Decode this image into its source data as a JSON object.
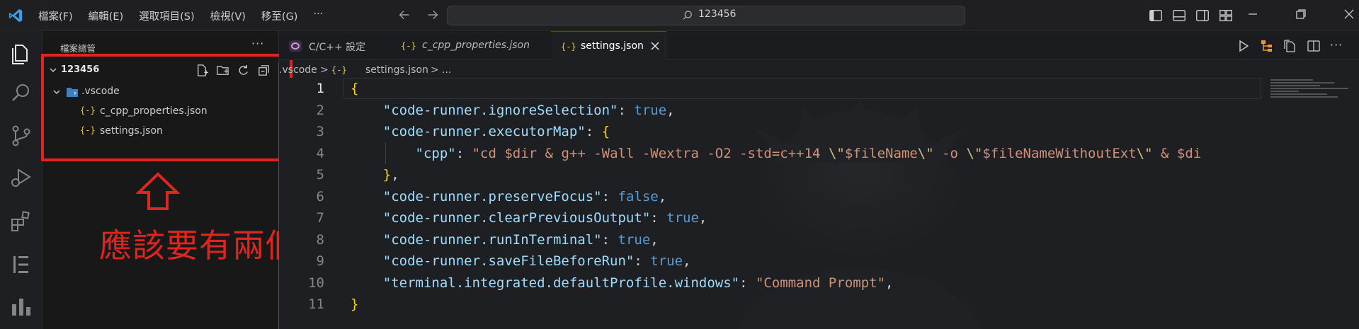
{
  "titlebar": {
    "menu": [
      "檔案(F)",
      "編輯(E)",
      "選取項目(S)",
      "檢視(V)",
      "移至(G)",
      "···"
    ],
    "search_text": "123456"
  },
  "explorer": {
    "title": "檔案總管",
    "more": "···",
    "folder": "123456",
    "tree": [
      {
        "label": ".vscode",
        "type": "folder"
      },
      {
        "label": "c_cpp_properties.json",
        "type": "json"
      },
      {
        "label": "settings.json",
        "type": "json"
      }
    ]
  },
  "annotation": {
    "text": "應該要有兩個檔案",
    "color": "#e0241f"
  },
  "tabs": [
    {
      "label": "C/C++ 設定",
      "icon": "cpp-icon"
    },
    {
      "label": "c_cpp_properties.json",
      "icon": "json-icon",
      "italic": true
    },
    {
      "label": "settings.json",
      "icon": "json-icon",
      "active": true
    }
  ],
  "json_icon_glyph": "{-}",
  "breadcrumb": {
    "folder": ".vscode",
    "sep": ">",
    "file": "settings.json",
    "rest": "..."
  },
  "editor": {
    "line_numbers": [
      "1",
      "2",
      "3",
      "4",
      "5",
      "6",
      "7",
      "8",
      "9",
      "10",
      "11"
    ],
    "current_line": "1",
    "lines": [
      [
        {
          "t": "{",
          "c": "b"
        }
      ],
      [
        {
          "t": "    "
        },
        {
          "t": "\"code-runner.ignoreSelection\"",
          "c": "k"
        },
        {
          "t": ": ",
          "c": "p"
        },
        {
          "t": "true",
          "c": "bool"
        },
        {
          "t": ",",
          "c": "p"
        }
      ],
      [
        {
          "t": "    "
        },
        {
          "t": "\"code-runner.executorMap\"",
          "c": "k"
        },
        {
          "t": ": ",
          "c": "p"
        },
        {
          "t": "{",
          "c": "b"
        }
      ],
      [
        {
          "t": "        "
        },
        {
          "t": "\"cpp\"",
          "c": "k"
        },
        {
          "t": ": ",
          "c": "p"
        },
        {
          "t": "\"cd $dir & g++ -Wall -Wextra -O2 -std=c++14 ",
          "c": "s"
        },
        {
          "t": "\\\"",
          "c": "esc"
        },
        {
          "t": "$fileName",
          "c": "s"
        },
        {
          "t": "\\\"",
          "c": "esc"
        },
        {
          "t": " -o ",
          "c": "s"
        },
        {
          "t": "\\\"",
          "c": "esc"
        },
        {
          "t": "$fileNameWithoutExt",
          "c": "s"
        },
        {
          "t": "\\\"",
          "c": "esc"
        },
        {
          "t": " & $di",
          "c": "s"
        }
      ],
      [
        {
          "t": "    "
        },
        {
          "t": "}",
          "c": "b"
        },
        {
          "t": ",",
          "c": "p"
        }
      ],
      [
        {
          "t": "    "
        },
        {
          "t": "\"code-runner.preserveFocus\"",
          "c": "k"
        },
        {
          "t": ": ",
          "c": "p"
        },
        {
          "t": "false",
          "c": "bool"
        },
        {
          "t": ",",
          "c": "p"
        }
      ],
      [
        {
          "t": "    "
        },
        {
          "t": "\"code-runner.clearPreviousOutput\"",
          "c": "k"
        },
        {
          "t": ": ",
          "c": "p"
        },
        {
          "t": "true",
          "c": "bool"
        },
        {
          "t": ",",
          "c": "p"
        }
      ],
      [
        {
          "t": "    "
        },
        {
          "t": "\"code-runner.runInTerminal\"",
          "c": "k"
        },
        {
          "t": ": ",
          "c": "p"
        },
        {
          "t": "true",
          "c": "bool"
        },
        {
          "t": ",",
          "c": "p"
        }
      ],
      [
        {
          "t": "    "
        },
        {
          "t": "\"code-runner.saveFileBeforeRun\"",
          "c": "k"
        },
        {
          "t": ": ",
          "c": "p"
        },
        {
          "t": "true",
          "c": "bool"
        },
        {
          "t": ",",
          "c": "p"
        }
      ],
      [
        {
          "t": "    "
        },
        {
          "t": "\"terminal.integrated.defaultProfile.windows\"",
          "c": "k"
        },
        {
          "t": ": ",
          "c": "p"
        },
        {
          "t": "\"Command Prompt\"",
          "c": "s"
        },
        {
          "t": ",",
          "c": "p"
        }
      ],
      [
        {
          "t": "}",
          "c": "b"
        }
      ]
    ]
  },
  "colors": {
    "accent": "#3b3fbf",
    "json_icon": "#e8c65a",
    "vscode_blue": "#3c9de8"
  }
}
